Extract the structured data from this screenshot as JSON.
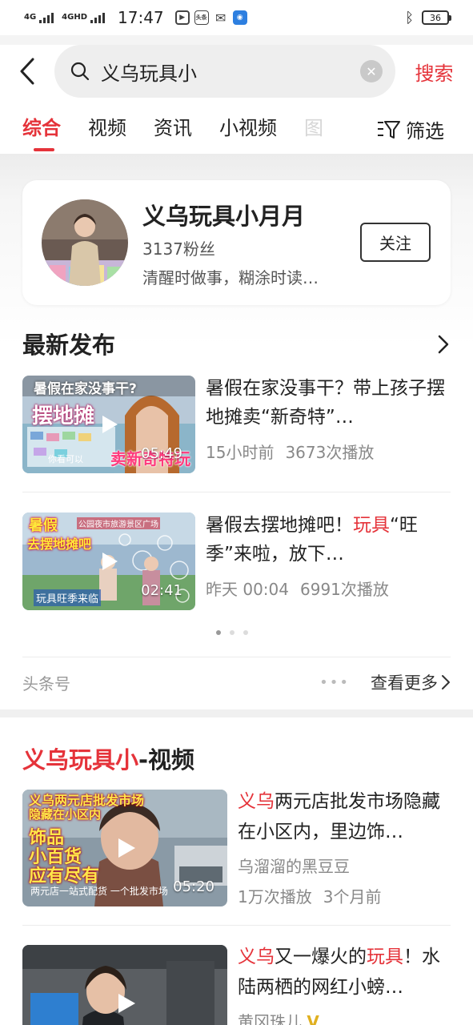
{
  "status_bar": {
    "net1": "4G",
    "net2": "4GHD",
    "time": "17:47",
    "app_icon_label": "头条",
    "battery": "36"
  },
  "search": {
    "query": "义乌玩具小",
    "button_label": "搜索"
  },
  "tabs": [
    {
      "label": "综合",
      "active": true
    },
    {
      "label": "视频"
    },
    {
      "label": "资讯"
    },
    {
      "label": "小视频"
    },
    {
      "label": "图"
    }
  ],
  "filter_label": "筛选",
  "profile": {
    "name": "义乌玩具小月月",
    "fans": "3137粉丝",
    "desc": "清醒时做事，糊涂时读…",
    "follow_label": "关注"
  },
  "latest": {
    "title": "最新发布",
    "videos": [
      {
        "title": "暑假在家没事干？带上孩子摆地摊卖“新奇特”…",
        "time": "15小时前",
        "plays": "3673次播放",
        "duration": "05:49",
        "thumb_text": [
          "暑假在家没事干?",
          "摆地摊",
          "你看可以",
          "卖新奇特玩具"
        ]
      },
      {
        "title_parts": [
          "暑假去摆地摊吧！",
          "玩具",
          "“旺季”来啦，放下…"
        ],
        "time": "昨天 00:04",
        "plays": "6991次播放",
        "duration": "02:41",
        "thumb_text": [
          "暑假",
          "去摆地摊吧",
          "公园夜市旅游景区广场",
          "玩具旺季来临"
        ]
      }
    ],
    "source": "头条号",
    "more_label": "查看更多"
  },
  "video_section": {
    "title_highlight": "义乌玩具小",
    "title_rest": "-视频",
    "items": [
      {
        "title_parts": [
          "义乌",
          "两元店批发市场隐藏在小区内，里边饰…"
        ],
        "author": "乌溜溜的黑豆豆",
        "plays": "1万次播放",
        "time": "3个月前",
        "duration": "05:20",
        "thumb_text": [
          "义乌两元店批发市场",
          "隐藏在小区内",
          "饰品",
          "小百货",
          "应有尽有",
          "两元店一站式配货 一个批发市场"
        ]
      },
      {
        "title_parts": [
          "义乌",
          "又一爆火的",
          "玩具",
          "！水陆两栖的网红小螃…"
        ],
        "author": "黄冈珠儿"
      }
    ]
  },
  "colors": {
    "accent": "#e5333a"
  }
}
